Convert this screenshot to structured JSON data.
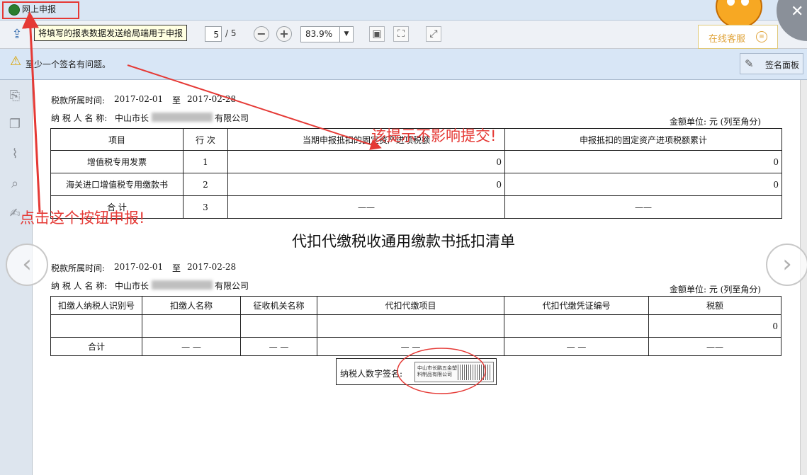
{
  "window": {
    "title": "网上申报"
  },
  "toolbar": {
    "tooltip": "将填写的报表数据发送给局端用于申报",
    "page_current": "5",
    "page_total": "/ 5",
    "zoom": "83.9%",
    "online_service": "在线客服",
    "annotate": "注释"
  },
  "signature_bar": {
    "warning": "至少一个签名有问题。",
    "panel_button": "签名面板"
  },
  "doc": {
    "section1": {
      "period_label": "税款所属时间:",
      "period_start": "2017-02-01",
      "period_to": "至",
      "period_end": "2017-02-28",
      "taxpayer_label": "纳 税 人 名 称:",
      "taxpayer_prefix": "中山市长",
      "taxpayer_suffix": "有限公司",
      "unit": "金额单位: 元 (列至角分)",
      "headers": [
        "项目",
        "行 次",
        "当期申报抵扣的固定资产进项税额",
        "申报抵扣的固定资产进项税额累计"
      ],
      "rows": [
        [
          "增值税专用发票",
          "1",
          "0",
          "0"
        ],
        [
          "海关进口增值税专用缴款书",
          "2",
          "0",
          "0"
        ],
        [
          "合    计",
          "3",
          "——",
          "——"
        ]
      ]
    },
    "title2": "代扣代缴税收通用缴款书抵扣清单",
    "section2": {
      "period_label": "税款所属时间:",
      "period_start": "2017-02-01",
      "period_to": "至",
      "period_end": "2017-02-28",
      "taxpayer_label": "纳 税 人 名 称:",
      "taxpayer_prefix": "中山市长",
      "taxpayer_suffix": "有限公司",
      "unit": "金额单位: 元 (列至角分)",
      "headers": [
        "扣缴人纳税人识别号",
        "扣缴人名称",
        "征收机关名称",
        "代扣代缴项目",
        "代扣代缴凭证编号",
        "税额"
      ],
      "empty_row_amount": "0",
      "total_row": [
        "合计",
        "— —",
        "— —",
        "— —",
        "— —",
        "——"
      ]
    },
    "signature_label": "纳税人数字签名:",
    "signature_stamp_text": "中山市长鹏五金塑料制品有限公司"
  },
  "annotations": {
    "tip_no_effect": "该提示不影响提交!",
    "click_button": "点击这个按钮申报!",
    "color": "#e53935"
  }
}
